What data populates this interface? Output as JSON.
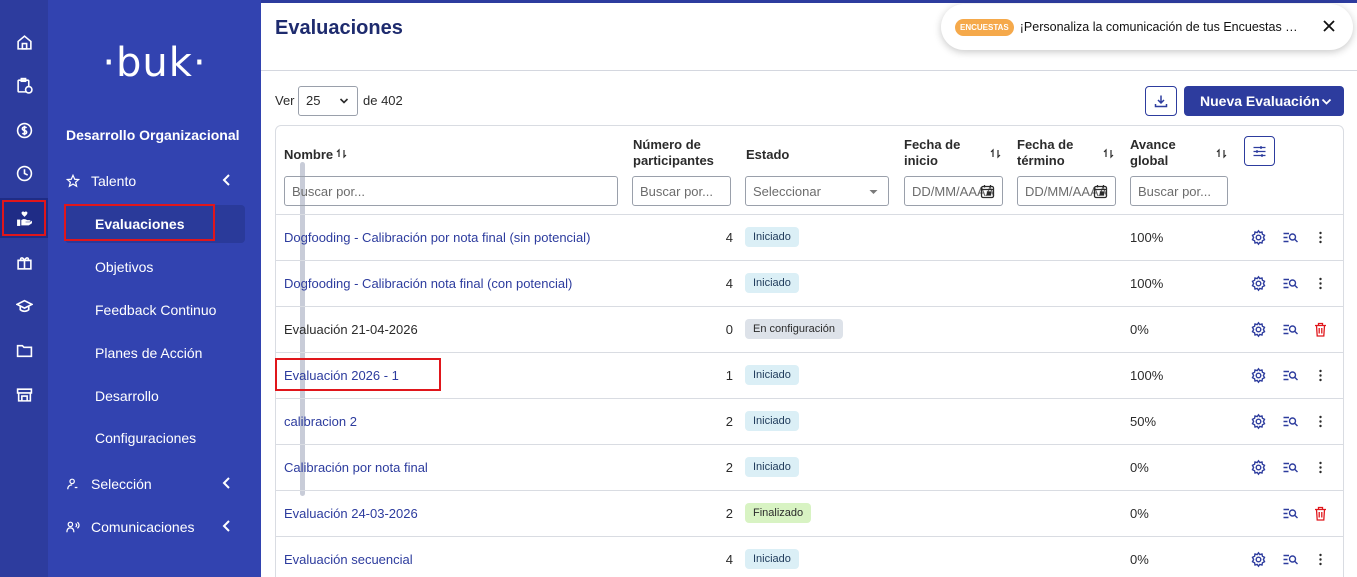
{
  "sidebar": {
    "logo": "·buk·",
    "section_title": "Desarrollo Organizacional",
    "groups": [
      {
        "label": "Talento"
      },
      {
        "label": "Selección"
      },
      {
        "label": "Comunicaciones"
      }
    ],
    "sub_items": [
      {
        "label": "Evaluaciones"
      },
      {
        "label": "Objetivos"
      },
      {
        "label": "Feedback Continuo"
      },
      {
        "label": "Planes de Acción"
      },
      {
        "label": "Desarrollo"
      },
      {
        "label": "Configuraciones"
      }
    ]
  },
  "header": {
    "title": "Evaluaciones"
  },
  "notification": {
    "badge": "ENCUESTAS",
    "text": "¡Personaliza la comunicación de tus Encuestas Libres!"
  },
  "toolbar": {
    "ver_label": "Ver",
    "per_page": "25",
    "total_label": "de 402",
    "new_button": "Nueva Evaluación"
  },
  "table": {
    "headers": {
      "nombre": "Nombre",
      "participantes_1": "Número de",
      "participantes_2": "participantes",
      "estado": "Estado",
      "inicio_1": "Fecha de",
      "inicio_2": "inicio",
      "termino_1": "Fecha de",
      "termino_2": "término",
      "avance_1": "Avance",
      "avance_2": "global"
    },
    "filters": {
      "nombre": "Buscar por...",
      "participantes": "Buscar por...",
      "estado": "Seleccionar",
      "inicio": "DD/MM/AAAA",
      "termino": "DD/MM/AAAA",
      "avance": "Buscar por..."
    },
    "rows": [
      {
        "name": "Dogfooding - Calibración por nota final (sin potencial)",
        "participants": "4",
        "status": "Iniciado",
        "progress": "100%"
      },
      {
        "name": "Dogfooding - Calibración nota final (con potencial)",
        "participants": "4",
        "status": "Iniciado",
        "progress": "100%"
      },
      {
        "name": "Evaluación 21-04-2026",
        "participants": "0",
        "status": "En configuración",
        "progress": "0%"
      },
      {
        "name": "Evaluación 2026 - 1",
        "participants": "1",
        "status": "Iniciado",
        "progress": "100%"
      },
      {
        "name": "calibracion 2",
        "participants": "2",
        "status": "Iniciado",
        "progress": "50%"
      },
      {
        "name": "Calibración por nota final",
        "participants": "2",
        "status": "Iniciado",
        "progress": "0%"
      },
      {
        "name": "Evaluación 24-03-2026",
        "participants": "2",
        "status": "Finalizado",
        "progress": "0%"
      },
      {
        "name": "Evaluación secuencial",
        "participants": "4",
        "status": "Iniciado",
        "progress": "0%"
      }
    ]
  },
  "colors": {
    "primary": "#2d3c9e",
    "sidebar": "#3243b0",
    "highlight": "#e0161b",
    "badge": "#f5a94b"
  }
}
